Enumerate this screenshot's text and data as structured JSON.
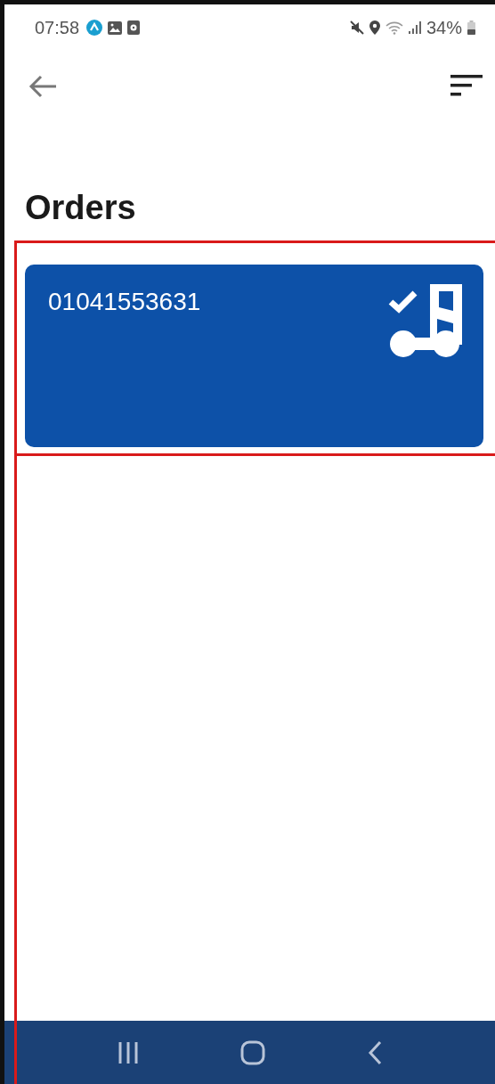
{
  "status_bar": {
    "time": "07:58",
    "battery": "34%"
  },
  "title": "Orders",
  "orders": [
    {
      "number": "01041553631"
    }
  ]
}
